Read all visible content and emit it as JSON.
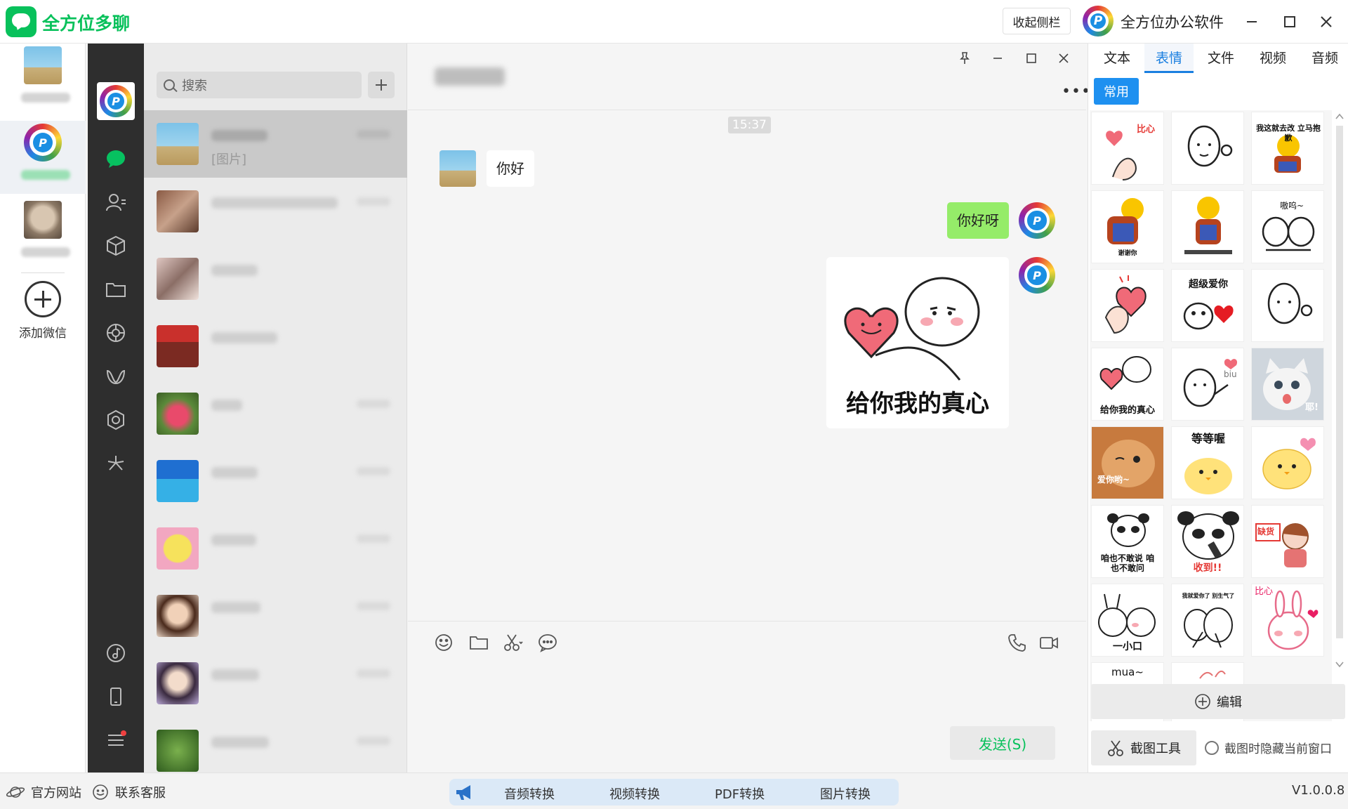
{
  "app": {
    "title": "全方位多聊",
    "collapse_label": "收起侧栏",
    "brand_name": "全方位办公软件"
  },
  "accounts": {
    "add_label": "添加微信"
  },
  "search": {
    "placeholder": "搜索"
  },
  "conversations": [
    {
      "preview": "[图片]"
    }
  ],
  "chat": {
    "timestamp": "15:37",
    "messages": [
      {
        "direction": "in",
        "text": "你好"
      },
      {
        "direction": "out",
        "text": "你好呀"
      },
      {
        "direction": "out",
        "sticker_caption": "给你我的真心"
      }
    ],
    "send_label": "发送(S)"
  },
  "panel": {
    "tabs": [
      "文本",
      "表情",
      "文件",
      "视频",
      "音频"
    ],
    "active_tab": "表情",
    "category": "常用",
    "edit_label": "编辑",
    "cut_label": "截图工具",
    "hide_option": "截图时隐藏当前窗口",
    "stickers": [
      {
        "caption": "比心"
      },
      {
        "caption": ""
      },
      {
        "caption": "我这就去改 立马抱歉"
      },
      {
        "caption": "谢谢你"
      },
      {
        "caption": ""
      },
      {
        "caption": "嗷呜~"
      },
      {
        "caption": ""
      },
      {
        "caption": "超级爱你"
      },
      {
        "caption": ""
      },
      {
        "caption": "给你我的真心"
      },
      {
        "caption": "biu"
      },
      {
        "caption": "耶!"
      },
      {
        "caption": "爱你哟~"
      },
      {
        "caption": "等等喔"
      },
      {
        "caption": ""
      },
      {
        "caption": "咱也不敢说 咱也不敢问"
      },
      {
        "caption": "收到!!"
      },
      {
        "caption": "缺货"
      },
      {
        "caption": "一小口"
      },
      {
        "caption": "我就爱你了 别生气了"
      },
      {
        "caption": "比心"
      },
      {
        "caption": "mua~"
      },
      {
        "caption": ""
      }
    ]
  },
  "statusbar": {
    "website": "官方网站",
    "support": "联系客服",
    "tools": [
      "音频转换",
      "视频转换",
      "PDF转换",
      "图片转换"
    ],
    "version": "V1.0.0.8"
  },
  "colors": {
    "brand_green": "#08c15b",
    "accent_blue": "#1a7fe0",
    "bubble_out": "#95ec69"
  }
}
